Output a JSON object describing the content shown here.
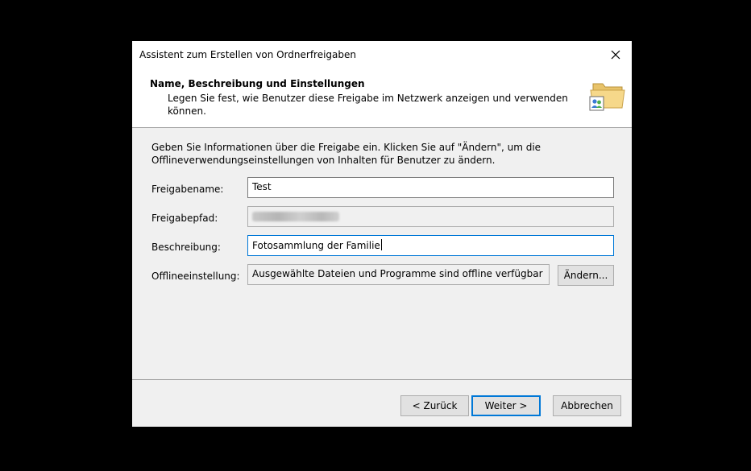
{
  "dialog": {
    "title": "Assistent zum Erstellen von Ordnerfreigaben",
    "close_icon": "close-icon"
  },
  "header": {
    "title": "Name, Beschreibung und Einstellungen",
    "subtitle": "Legen Sie fest, wie Benutzer diese Freigabe im Netzwerk anzeigen und verwenden können.",
    "icon": "shared-folder-icon"
  },
  "intro": "Geben Sie Informationen über die Freigabe ein. Klicken Sie auf \"Ändern\", um die Offlineverwendungseinstellungen von Inhalten für Benutzer zu ändern.",
  "form": {
    "share_name_label": "Freigabename:",
    "share_name_value": "Test",
    "share_path_label": "Freigabepfad:",
    "description_label": "Beschreibung:",
    "description_value": "Fotosammlung der Familie",
    "offline_label": "Offlineeinstellung:",
    "offline_value": "Ausgewählte Dateien und Programme sind offline verfügbar",
    "change_button": "Ändern..."
  },
  "footer": {
    "back_button": "< Zurück",
    "next_button": "Weiter >",
    "cancel_button": "Abbrechen"
  },
  "colors": {
    "focus_border": "#0078d7",
    "dialog_bg": "#f0f0f0"
  }
}
